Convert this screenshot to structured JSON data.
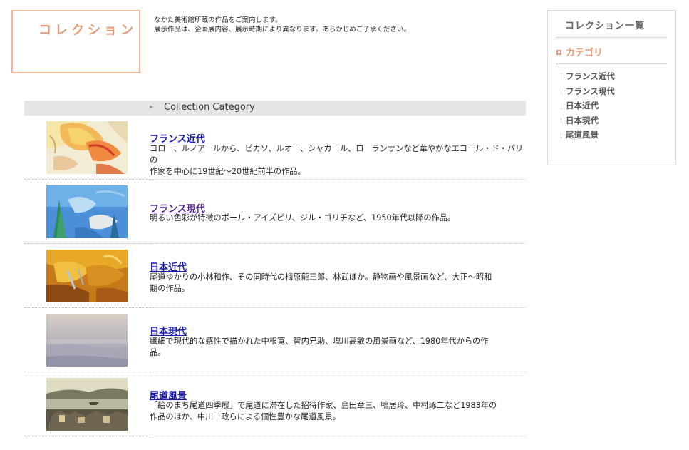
{
  "header": {
    "title": "コレクション",
    "intro_line1": "なかた美術館所蔵の作品をご案内します。",
    "intro_line2": "展示作品は、企画展内容、展示時期により異なります。あらかじめご了承ください。"
  },
  "category_bar": {
    "title": "Collection Category"
  },
  "items": [
    {
      "name": "フランス近代",
      "desc_line1": "コロー、ルノアールから、ピカソ、ルオー、シャガール、ローランサンなど華やかなエコール・ド・パリの",
      "desc_line2": "作家を中心に19世紀〜20世紀前半の作品。"
    },
    {
      "name": "フランス現代",
      "desc_line1": "明るい色彩が特徴のポール・アイズピリ、ジル・ゴリチなど、1950年代以降の作品。",
      "desc_line2": ""
    },
    {
      "name": "日本近代",
      "desc_line1": "尾道ゆかりの小林和作、その同時代の梅原龍三郎、林武ほか。静物画や風景画など、大正〜昭和",
      "desc_line2": "期の作品。"
    },
    {
      "name": "日本現代",
      "desc_line1": "繊細で現代的な感性で描かれた中根寛、智内兄助、塩川高敏の風景画など、1980年代からの作",
      "desc_line2": "品。"
    },
    {
      "name": "尾道風景",
      "desc_line1": "「絵のまち尾道四季展」で尾道に滞在した招待作家、島田章三、鴨居玲、中村琢二など1983年の",
      "desc_line2": "作品のほか、中川一政らによる個性豊かな尾道風景。"
    }
  ],
  "sidebar": {
    "title": "コレクション一覧",
    "category_heading": "カテゴリ",
    "links": [
      "フランス近代",
      "フランス現代",
      "日本近代",
      "日本現代",
      "尾道風景"
    ]
  },
  "colors": {
    "accent": "#e39a78",
    "link": "#1a1aa8",
    "visited": "#5a2a8a"
  }
}
